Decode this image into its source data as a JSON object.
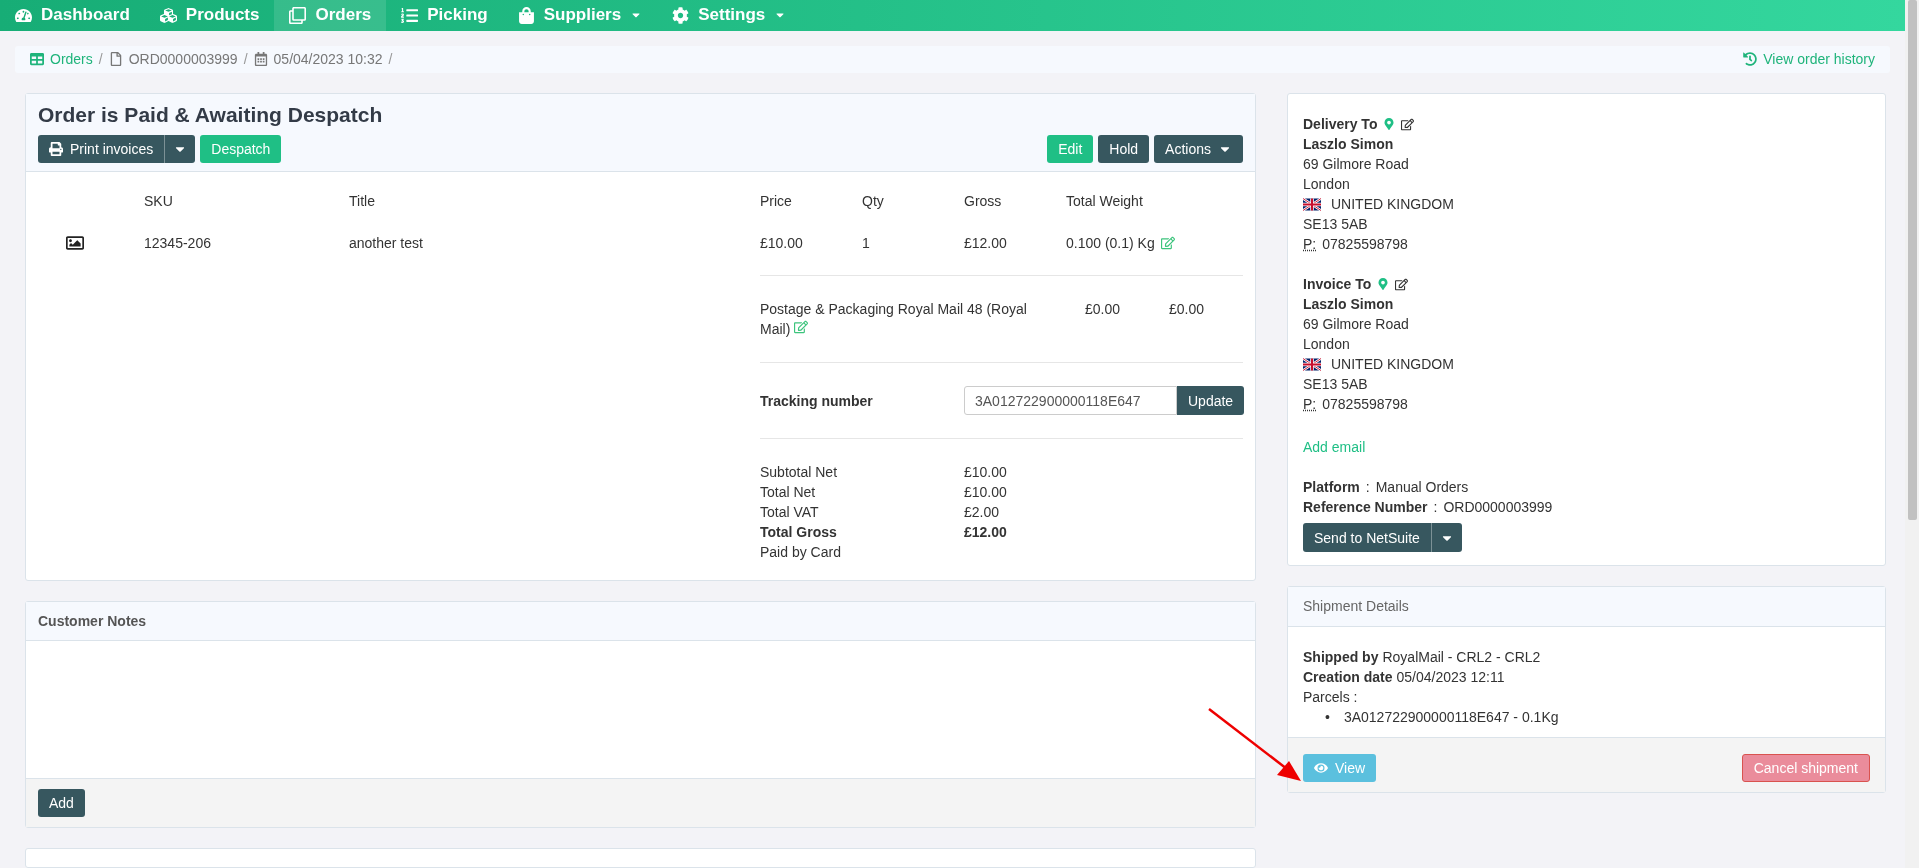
{
  "nav": [
    {
      "label": "Dashboard",
      "selected": false,
      "caret": false
    },
    {
      "label": "Products",
      "selected": false,
      "caret": false
    },
    {
      "label": "Orders",
      "selected": true,
      "caret": false
    },
    {
      "label": "Picking",
      "selected": false,
      "caret": false
    },
    {
      "label": "Suppliers",
      "selected": false,
      "caret": true
    },
    {
      "label": "Settings",
      "selected": false,
      "caret": true
    }
  ],
  "breadcrumb": {
    "separator": "/",
    "items": [
      {
        "label": "Orders",
        "link": true
      },
      {
        "label": "ORD0000003999",
        "link": false
      },
      {
        "label": "05/04/2023 10:32",
        "link": false
      }
    ],
    "history_link": "View order history"
  },
  "order": {
    "title": "Order is Paid & Awaiting Despatch",
    "left_buttons": [
      {
        "label": "Print invoices",
        "kind": "split"
      },
      {
        "label": "Despatch",
        "kind": "success"
      }
    ],
    "right_buttons": [
      {
        "label": "Edit",
        "kind": "success"
      },
      {
        "label": "Hold",
        "kind": "dark"
      },
      {
        "label": "Actions",
        "kind": "dropdown"
      }
    ],
    "columns": [
      "SKU",
      "Title",
      "Price",
      "Qty",
      "Gross",
      "Total Weight"
    ],
    "rows": [
      {
        "cells": [
          "12345-206",
          "another test",
          "£10.00",
          "1",
          "£12.00",
          "0.100 (0.1) Kg"
        ]
      }
    ],
    "postage": {
      "label": "Postage & Packaging Royal Mail 48 (Royal Mail)",
      "price": "£0.00",
      "gross": "£0.00"
    },
    "tracking": {
      "label": "Tracking number",
      "value": "3A012722900000118E647",
      "button": "Update"
    },
    "totals": [
      {
        "label": "Subtotal Net",
        "value": "£10.00",
        "bold": false
      },
      {
        "label": "Total Net",
        "value": "£10.00",
        "bold": false
      },
      {
        "label": "Total VAT",
        "value": "£2.00",
        "bold": false
      },
      {
        "label": "Total Gross",
        "value": "£12.00",
        "bold": true
      }
    ],
    "payment_note": "Paid by Card"
  },
  "customer_notes": {
    "title": "Customer Notes",
    "button": "Add"
  },
  "addresses": [
    {
      "heading": "Delivery To",
      "name": "Laszlo Simon",
      "lines": [
        "69 Gilmore Road",
        "London"
      ],
      "country": "UNITED KINGDOM",
      "postcode": "SE13 5AB",
      "phone_label": "P:",
      "phone": "07825598798"
    },
    {
      "heading": "Invoice To",
      "name": "Laszlo Simon",
      "lines": [
        "69 Gilmore Road",
        "London"
      ],
      "country": "UNITED KINGDOM",
      "postcode": "SE13 5AB",
      "phone_label": "P:",
      "phone": "07825598798"
    }
  ],
  "add_email": "Add email",
  "meta": [
    {
      "label": "Platform",
      "colon": ":",
      "value": "Manual Orders"
    },
    {
      "label": "Reference Number",
      "colon": ":",
      "value": "ORD0000003999"
    }
  ],
  "send_button": "Send to NetSuite",
  "shipment": {
    "title": "Shipment Details",
    "fields": [
      {
        "label": "Shipped by",
        "value": "RoyalMail - CRL2 - CRL2"
      },
      {
        "label": "Creation date",
        "value": "05/04/2023 12:11"
      }
    ],
    "parcels_label": "Parcels :",
    "parcels": [
      {
        "marker": "•",
        "text": "3A012722900000118E647 - 0.1Kg"
      }
    ],
    "view_button": "View",
    "cancel_button": "Cancel shipment"
  }
}
